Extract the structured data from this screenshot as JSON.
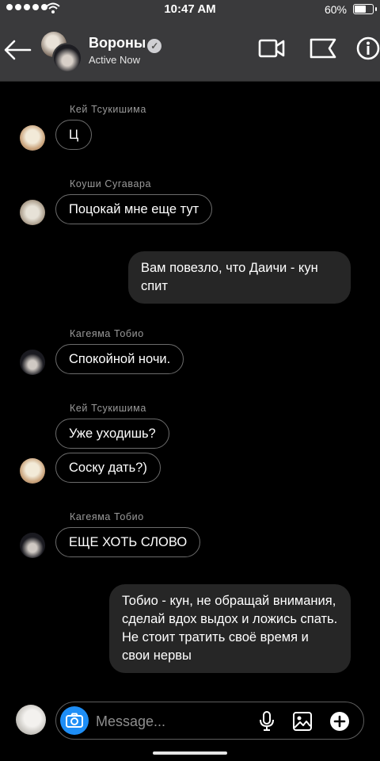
{
  "status_bar": {
    "time": "10:47 AM",
    "battery": "60%",
    "battery_level": 0.6
  },
  "header": {
    "title": "Вороны",
    "subtitle": "Active Now"
  },
  "messages": [
    {
      "sender": "Кей Тсукишима",
      "text": "Ц"
    },
    {
      "sender": "Коуши Сугавара",
      "text": "Поцокай мне еще тут"
    },
    {
      "text": "Вам повезло, что Даичи - кун спит"
    },
    {
      "sender": "Кагеяма Тобио",
      "text": "Спокойной ночи."
    },
    {
      "sender": "Кей Тсукишима",
      "text": "Уже уходишь?"
    },
    {
      "text": "Соску дать?)"
    },
    {
      "sender": "Кагеяма Тобио",
      "text": "ЕЩЕ ХОТЬ СЛОВО"
    },
    {
      "text": "Тобио - кун, не обращай внимания, сделай вдох выдох и ложись спать. Не стоит тратить своё время и свои нервы"
    }
  ],
  "composer": {
    "placeholder": "Message..."
  },
  "colors": {
    "camera_button": "#1e8ef6",
    "background": "#000000",
    "header": "#3a3a3c",
    "outgoing_bubble": "#262626"
  }
}
